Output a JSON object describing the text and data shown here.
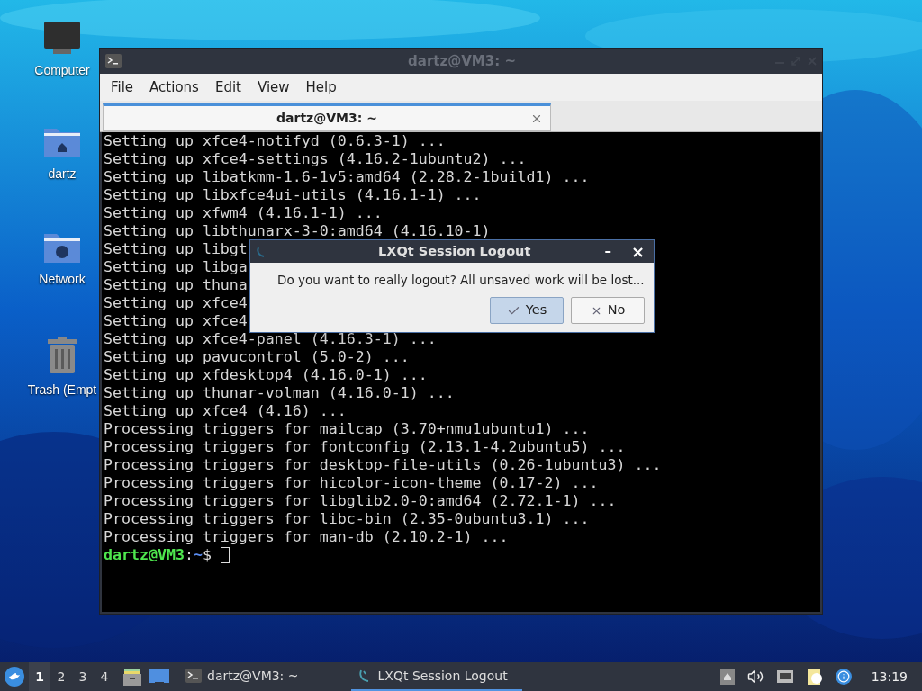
{
  "desktop_icons": [
    {
      "label": "Computer",
      "kind": "computer"
    },
    {
      "label": "dartz",
      "kind": "home"
    },
    {
      "label": "Network",
      "kind": "network"
    },
    {
      "label": "Trash (Empt",
      "kind": "trash"
    }
  ],
  "terminal": {
    "title": "dartz@VM3: ~",
    "menu": [
      "File",
      "Actions",
      "Edit",
      "View",
      "Help"
    ],
    "tabs": [
      {
        "label": "dartz@VM3: ~",
        "selected": true
      }
    ],
    "lines": [
      "Setting up xfce4-notifyd (0.6.3-1) ...",
      "Setting up xfce4-settings (4.16.2-1ubuntu2) ...",
      "Setting up libatkmm-1.6-1v5:amd64 (2.28.2-1build1) ...",
      "Setting up libxfce4ui-utils (4.16.1-1) ...",
      "Setting up xfwm4 (4.16.1-1) ...",
      "Setting up libthunarx-3-0:amd64 (4.16.10-1)",
      "Setting up libgt",
      "Setting up libga",
      "Setting up thuna",
      "Setting up xfce4",
      "Setting up xfce4",
      "Setting up xfce4-panel (4.16.3-1) ...",
      "Setting up pavucontrol (5.0-2) ...",
      "Setting up xfdesktop4 (4.16.0-1) ...",
      "Setting up thunar-volman (4.16.0-1) ...",
      "Setting up xfce4 (4.16) ...",
      "Processing triggers for mailcap (3.70+nmu1ubuntu1) ...",
      "Processing triggers for fontconfig (2.13.1-4.2ubuntu5) ...",
      "Processing triggers for desktop-file-utils (0.26-1ubuntu3) ...",
      "Processing triggers for hicolor-icon-theme (0.17-2) ...",
      "Processing triggers for libglib2.0-0:amd64 (2.72.1-1) ...",
      "Processing triggers for libc-bin (2.35-0ubuntu3.1) ...",
      "Processing triggers for man-db (2.10.2-1) ..."
    ],
    "prompt": {
      "user_host": "dartz@VM3",
      "separator": ":",
      "path": "~",
      "symbol": "$"
    }
  },
  "dialog": {
    "title": "LXQt Session Logout",
    "minimize": "–",
    "close": "×",
    "message": "Do you want to really logout? All unsaved work will be lost...",
    "buttons": [
      {
        "label": "Yes",
        "kind": "confirm",
        "selected": true
      },
      {
        "label": "No",
        "kind": "cancel",
        "selected": false
      }
    ]
  },
  "taskbar": {
    "workspaces": [
      {
        "label": "1",
        "selected": true
      },
      {
        "label": "2",
        "selected": false
      },
      {
        "label": "3",
        "selected": false
      },
      {
        "label": "4",
        "selected": false
      }
    ],
    "tasks": [
      {
        "label": "dartz@VM3: ~",
        "kind": "terminal",
        "selected": false
      },
      {
        "label": "LXQt Session Logout",
        "kind": "dialog",
        "selected": true
      }
    ],
    "clock": "13:19"
  }
}
